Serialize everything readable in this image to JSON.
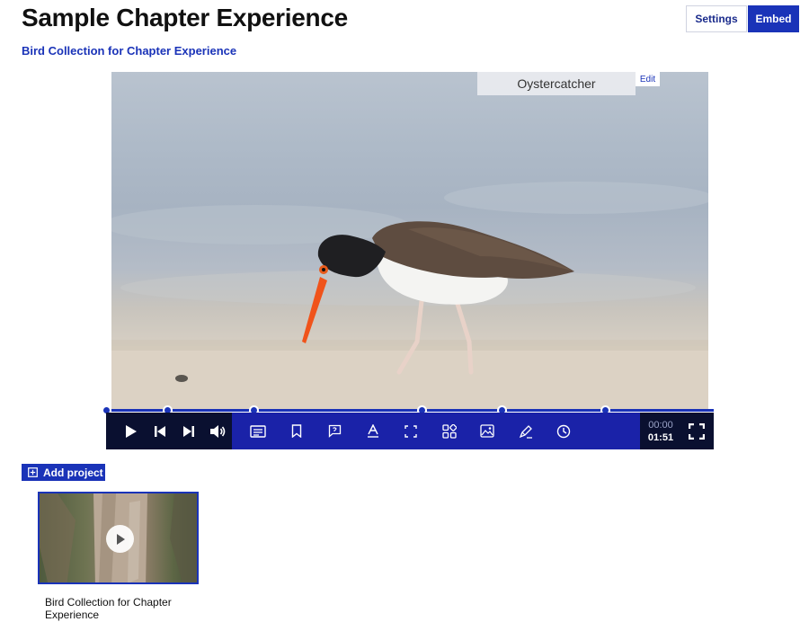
{
  "header": {
    "title": "Sample Chapter Experience",
    "settings_label": "Settings",
    "embed_label": "Embed",
    "subtitle": "Bird Collection for Chapter Experience"
  },
  "player": {
    "chapter_title": "Oystercatcher",
    "edit_label": "Edit",
    "current_time": "00:00",
    "duration": "01:51",
    "progress": 0,
    "chapter_markers_count": 7,
    "icons": {
      "left": [
        "play-icon",
        "previous-chapter-icon",
        "next-chapter-icon",
        "volume-icon"
      ],
      "middle": [
        "transcript-icon",
        "bookmark-icon",
        "comment-icon",
        "caption-icon",
        "focus-icon",
        "apps-icon",
        "image-icon",
        "annotate-icon",
        "history-icon"
      ],
      "right": [
        "fullscreen-icon"
      ]
    },
    "accent_color": "#1a33b8",
    "bar_color": "#1a22a8",
    "dark_color": "#0a1030"
  },
  "projects": {
    "add_label": "Add project",
    "items": [
      {
        "title": "Bird Collection for Chapter Experience"
      }
    ]
  }
}
